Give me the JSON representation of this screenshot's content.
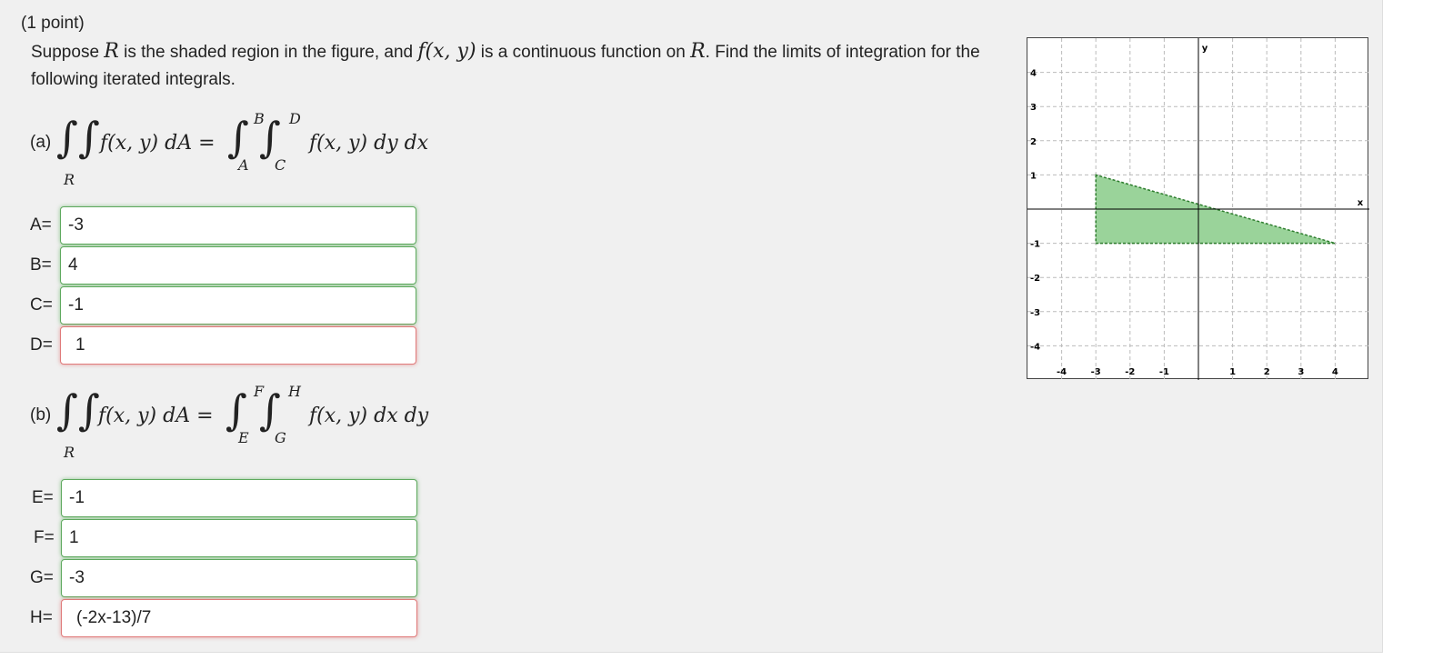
{
  "problem": {
    "points": "(1 point)",
    "prompt_pre": "Suppose ",
    "prompt_R": "R",
    "prompt_mid": " is the shaded region in the figure, and ",
    "prompt_f": "f(x, y)",
    "prompt_mid2": " is a continuous function on ",
    "prompt_R2": "R",
    "prompt_post": ". Find the limits of integration for the following iterated integrals."
  },
  "part_a": {
    "label": "(a)",
    "lhs": "f(x, y) dA =",
    "region": "R",
    "upper_outer": "B",
    "lower_outer": "A",
    "upper_inner": "D",
    "lower_inner": "C",
    "integrand": "f(x, y) dy dx",
    "answers": [
      {
        "label": "A=",
        "value": "-3",
        "status": "correct"
      },
      {
        "label": "B=",
        "value": "4",
        "status": "correct"
      },
      {
        "label": "C=",
        "value": "-1",
        "status": "correct"
      },
      {
        "label": "D=",
        "value": "1",
        "status": "wrong"
      }
    ]
  },
  "part_b": {
    "label": "(b)",
    "lhs": "f(x, y) dA =",
    "region": "R",
    "upper_outer": "F",
    "lower_outer": "E",
    "upper_inner": "H",
    "lower_inner": "G",
    "integrand": "f(x, y) dx dy",
    "answers": [
      {
        "label": "E=",
        "value": "-1",
        "status": "correct"
      },
      {
        "label": "F=",
        "value": "1",
        "status": "correct"
      },
      {
        "label": "G=",
        "value": "-3",
        "status": "correct"
      },
      {
        "label": "H=",
        "value": "(-2x-13)/7",
        "status": "wrong"
      }
    ]
  },
  "graph": {
    "x_axis_label": "x",
    "y_axis_label": "y",
    "x_range": [
      -5,
      5
    ],
    "y_range": [
      -5,
      5
    ],
    "x_ticks": [
      "-4",
      "-3",
      "-2",
      "-1",
      "1",
      "2",
      "3",
      "4"
    ],
    "y_ticks": [
      "4",
      "3",
      "2",
      "1",
      "-1",
      "-2",
      "-3",
      "-4"
    ],
    "region_vertices": [
      [
        -3,
        1
      ],
      [
        -3,
        -1
      ],
      [
        4,
        -1
      ]
    ],
    "fill_color": "#9ad39a",
    "edge_color": "#2e7d2e"
  }
}
